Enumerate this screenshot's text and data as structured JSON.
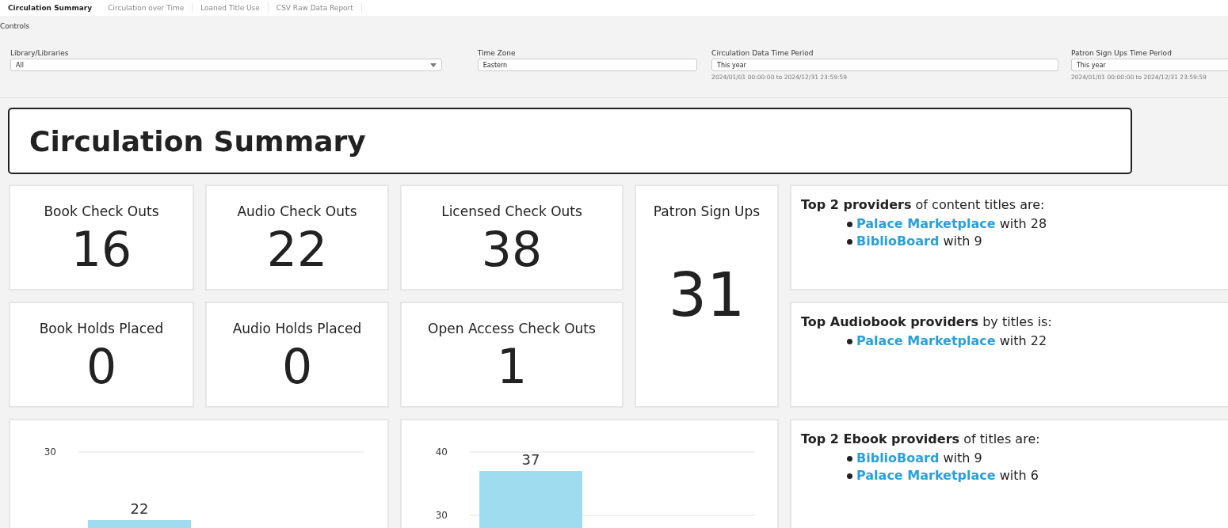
{
  "tabs": [
    {
      "label": "Circulation Summary",
      "selected": true
    },
    {
      "label": "Circulation over Time",
      "selected": false
    },
    {
      "label": "Loaned Title Use",
      "selected": false
    },
    {
      "label": "CSV Raw Data Report",
      "selected": false
    }
  ],
  "controls": {
    "title": "Controls",
    "fields": [
      {
        "label": "Library/Libraries",
        "value": "All",
        "kind": "dropdown"
      },
      {
        "label": "Time Zone",
        "value": "Eastern",
        "kind": "text"
      },
      {
        "label": "Circulation Data Time Period",
        "value": "This year",
        "hint": "2024/01/01 00:00:00 to 2024/12/31 23:59:59",
        "kind": "text"
      },
      {
        "label": "Patron Sign Ups Time Period",
        "value": "This year",
        "hint": "2024/01/01 00:00:00 to 2024/12/31 23:59:59",
        "kind": "text"
      }
    ]
  },
  "heading": "Circulation Summary",
  "kpis": [
    {
      "label": "Book Check Outs",
      "value": "16"
    },
    {
      "label": "Audio Check Outs",
      "value": "22"
    },
    {
      "label": "Licensed Check Outs",
      "value": "38"
    },
    {
      "label": "Patron Sign Ups",
      "value": "31"
    },
    {
      "label": "Book Holds Placed",
      "value": "0"
    },
    {
      "label": "Audio Holds Placed",
      "value": "0"
    },
    {
      "label": "Open Access Check Outs",
      "value": "1"
    }
  ],
  "providers": [
    {
      "title": "**Top 2 providers** of content titles are:",
      "items": [
        {
          "name": "Palace Marketplace",
          "rest": "with 28"
        },
        {
          "name": "BiblioBoard",
          "rest": "with 9"
        }
      ]
    },
    {
      "title": "**Top  Audiobook providers** by  titles is:",
      "items": [
        {
          "name": "Palace Marketplace",
          "rest": "with 22"
        }
      ]
    },
    {
      "title": "**Top  2 Ebook providers** of titles are:",
      "items": [
        {
          "name": "BiblioBoard",
          "rest": "with 9"
        },
        {
          "name": "Palace Marketplace",
          "rest": "with 6"
        }
      ]
    }
  ],
  "bar_picture": {
    "tick_label": "30",
    "bar_label": "22"
  },
  "charts": [
    {
      "chart_data": {
        "type": "bar",
        "values": [
          37
        ],
        "yticks": [
          30,
          40
        ],
        "ylim": [
          0,
          40
        ],
        "data_labels": true
      }
    }
  ]
}
